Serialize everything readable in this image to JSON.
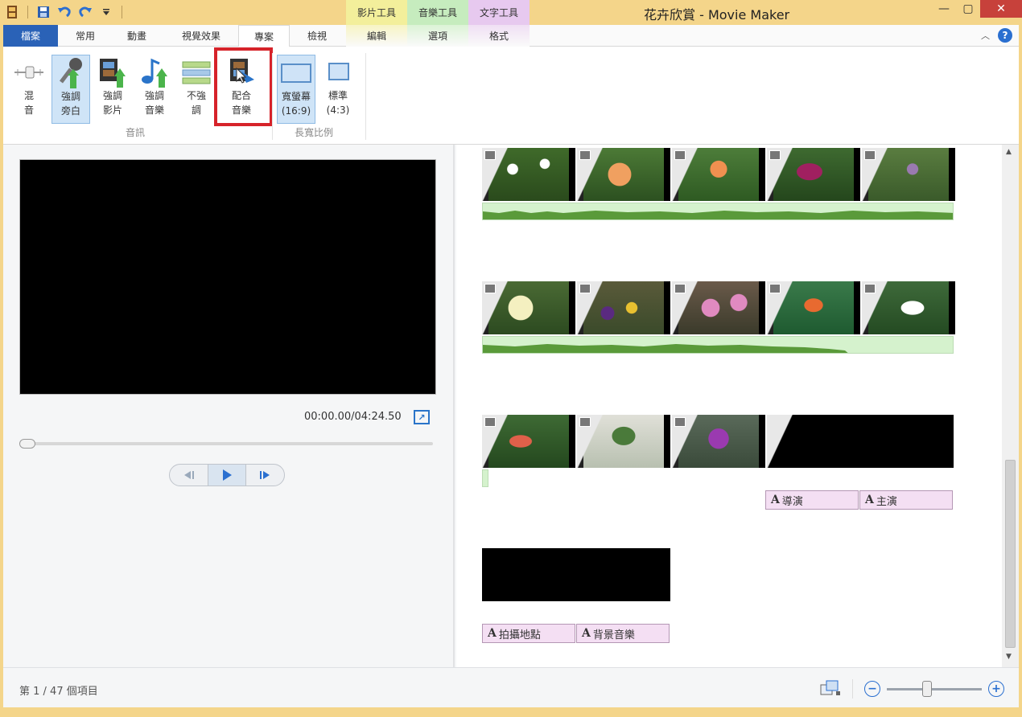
{
  "window": {
    "title": "花卉欣賞 - Movie Maker",
    "context_tabs": [
      "影片工具",
      "音樂工具",
      "文字工具"
    ],
    "controls": {
      "minimize": "—",
      "maximize": "▢",
      "close": "✕"
    }
  },
  "tabs": {
    "file": "檔案",
    "home": "常用",
    "animation": "動畫",
    "visual_effects": "視覺效果",
    "project": "專案",
    "view": "檢視",
    "edit": "編輯",
    "options": "選項",
    "format": "格式"
  },
  "ribbon": {
    "buttons": [
      {
        "id": "mix",
        "label": "混\n音"
      },
      {
        "id": "narration",
        "label": "強調\n旁白"
      },
      {
        "id": "video",
        "label": "強調\n影片"
      },
      {
        "id": "music",
        "label": "強調\n音樂"
      },
      {
        "id": "none",
        "label": "不強\n調"
      },
      {
        "id": "fit",
        "label": "配合\n音樂"
      },
      {
        "id": "wide",
        "label": "寬螢幕\n(16:9)"
      },
      {
        "id": "standard",
        "label": "標準\n(4:3)"
      }
    ],
    "groups": {
      "audio": "音訊",
      "aspect": "長寬比例"
    }
  },
  "preview": {
    "timecode": "00:00.00/04:24.50"
  },
  "storyboard": {
    "text_tags_row3": [
      "導演",
      "主演"
    ],
    "text_tags_row4": [
      "拍攝地點",
      "背景音樂"
    ],
    "tag_glyph": "A"
  },
  "status": {
    "item_count": "第 1 / 47 個項目"
  },
  "colors": {
    "frame": "#f4d58a",
    "file_tab": "#2a62b7",
    "highlight": "#d6232a",
    "ctx_video": "#f3ef9b",
    "ctx_music": "#c6ecbe",
    "ctx_text": "#e7c9ef"
  }
}
